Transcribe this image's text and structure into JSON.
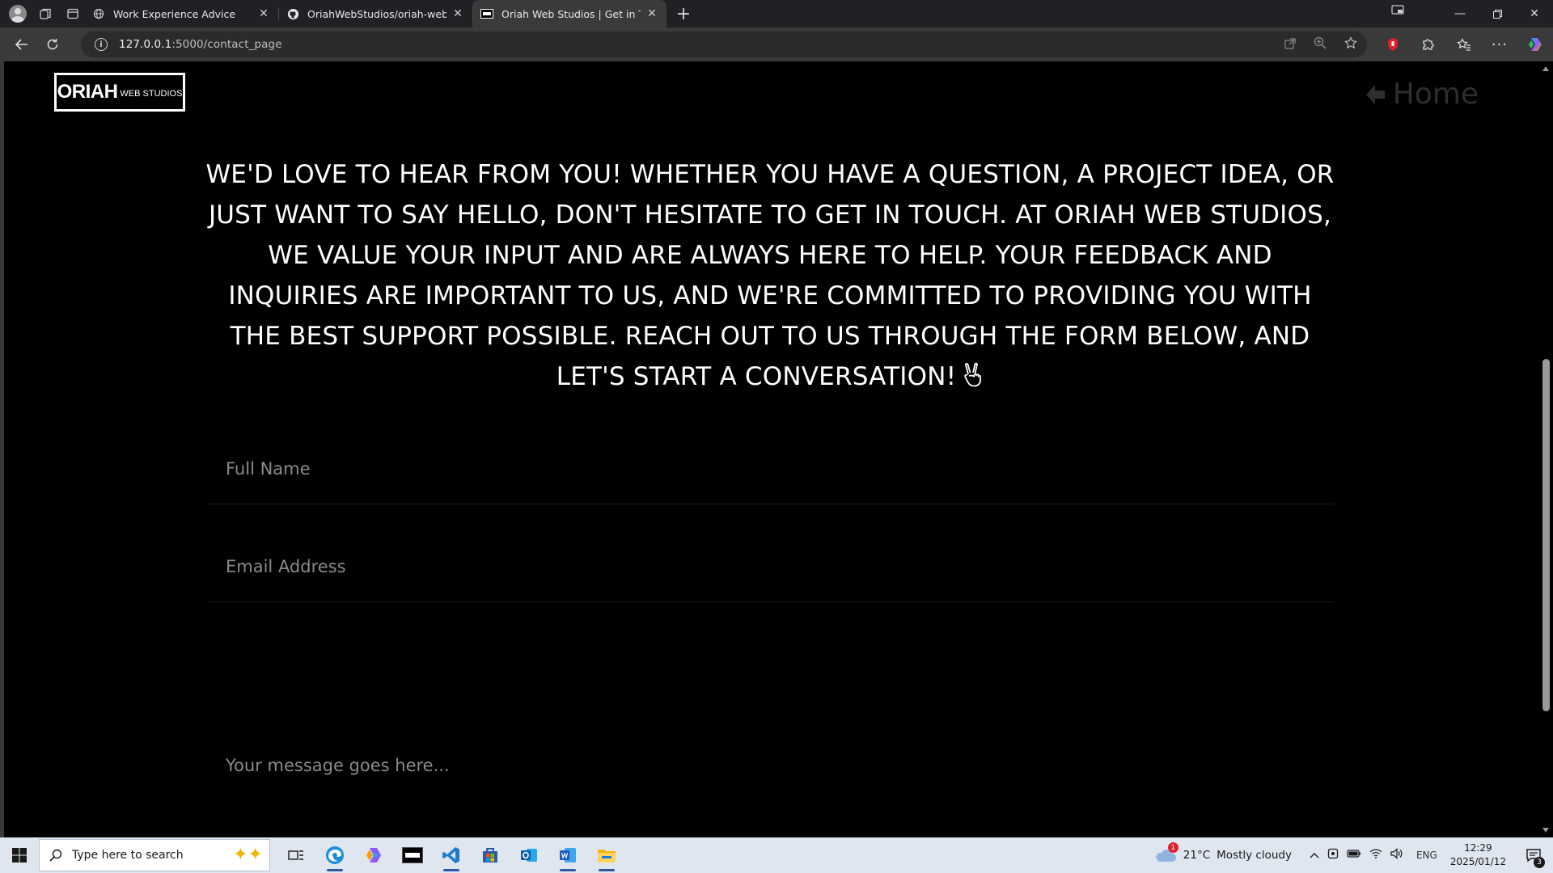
{
  "browser": {
    "tabs": [
      {
        "title": "Work Experience Advice",
        "active": false
      },
      {
        "title": "OriahWebStudios/oriah-web-stud",
        "active": false
      },
      {
        "title": "Oriah Web Studios | Get in Touch",
        "active": true
      }
    ],
    "url_host": "127.0.0.1",
    "url_rest": ":5000/contact_page"
  },
  "page": {
    "logo_main": "ORIAH",
    "logo_sub": "WEB STUDIOS",
    "home_label": "Home",
    "intro_text": "WE'D LOVE TO HEAR FROM YOU! WHETHER YOU HAVE A QUESTION, A PROJECT IDEA, OR JUST WANT TO SAY HELLO, DON'T HESITATE TO GET IN TOUCH. AT ORIAH WEB STUDIOS, WE VALUE YOUR INPUT AND ARE ALWAYS HERE TO HELP. YOUR FEEDBACK AND INQUIRIES ARE IMPORTANT TO US, AND WE'RE COMMITTED TO PROVIDING YOU WITH THE BEST SUPPORT POSSIBLE. REACH OUT TO US THROUGH THE FORM BELOW, AND LET'S START A CONVERSATION!",
    "form": {
      "name_placeholder": "Full Name",
      "email_placeholder": "Email Address",
      "message_placeholder": "Your message goes here..."
    }
  },
  "taskbar": {
    "search_placeholder": "Type here to search",
    "weather_temp": "21°C",
    "weather_desc": "Mostly cloudy",
    "weather_alert": "1",
    "lang": "ENG",
    "time": "12:29",
    "date": "2025/01/12",
    "notification_count": "3"
  },
  "colors": {
    "page_bg": "#000000",
    "text": "#ffffff",
    "placeholder": "#8a8a8a",
    "home_link": "#2e2e2e",
    "chrome_dark": "#202124",
    "taskbar_bg": "#dfe6ef"
  }
}
